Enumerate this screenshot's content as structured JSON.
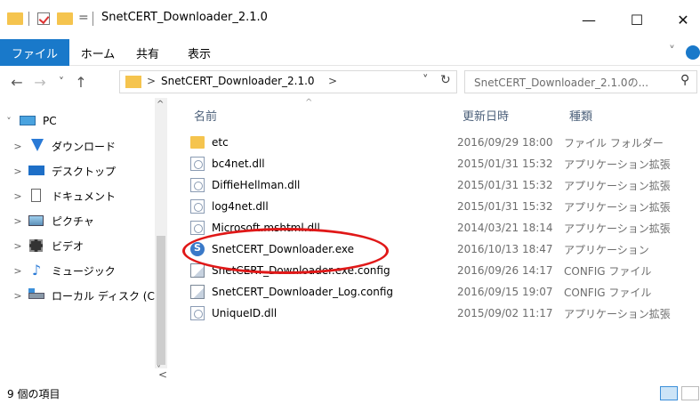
{
  "window": {
    "title": "SnetCERT_Downloader_2.1.0",
    "qat_dropdown": "=",
    "minimize": "—",
    "maximize": "☐",
    "close": "✕"
  },
  "ribbon": {
    "tabs": [
      {
        "label": "ファイル"
      },
      {
        "label": "ホーム"
      },
      {
        "label": "共有"
      },
      {
        "label": "表示"
      }
    ],
    "expand": "˅"
  },
  "address": {
    "back": "←",
    "forward": "→",
    "recent": "˅",
    "up": "↑",
    "crumb_sep": ">",
    "path": "SnetCERT_Downloader_2.1.0",
    "path_sep": ">",
    "dropdown": "˅",
    "refresh": "↻",
    "search_placeholder": "SnetCERT_Downloader_2.1.0の...",
    "search_icon": "⚲"
  },
  "nav": {
    "items": [
      {
        "label": "PC",
        "icon": "pc-icon",
        "expanded": true
      },
      {
        "label": "ダウンロード",
        "icon": "download-icon"
      },
      {
        "label": "デスクトップ",
        "icon": "desktop-icon"
      },
      {
        "label": "ドキュメント",
        "icon": "documents-icon"
      },
      {
        "label": "ピクチャ",
        "icon": "pictures-icon"
      },
      {
        "label": "ビデオ",
        "icon": "videos-icon"
      },
      {
        "label": "ミュージック",
        "icon": "music-icon"
      },
      {
        "label": "ローカル ディスク (C",
        "icon": "local-disk-icon"
      }
    ],
    "chev_expanded": "˅",
    "chev_collapsed": ">"
  },
  "columns": {
    "name": "名前",
    "date": "更新日時",
    "type": "種類",
    "sort_indicator": "^"
  },
  "files": [
    {
      "name": "etc",
      "date": "2016/09/29 18:00",
      "type": "ファイル フォルダー",
      "icon": "folder"
    },
    {
      "name": "bc4net.dll",
      "date": "2015/01/31 15:32",
      "type": "アプリケーション拡張",
      "icon": "dll"
    },
    {
      "name": "DiffieHellman.dll",
      "date": "2015/01/31 15:32",
      "type": "アプリケーション拡張",
      "icon": "dll"
    },
    {
      "name": "log4net.dll",
      "date": "2015/01/31 15:32",
      "type": "アプリケーション拡張",
      "icon": "dll"
    },
    {
      "name": "Microsoft.mshtml.dll",
      "date": "2014/03/21 18:14",
      "type": "アプリケーション拡張",
      "icon": "dll"
    },
    {
      "name": "SnetCERT_Downloader.exe",
      "date": "2016/10/13 18:47",
      "type": "アプリケーション",
      "icon": "exe"
    },
    {
      "name": "SnetCERT_Downloader.exe.config",
      "date": "2016/09/26 14:17",
      "type": "CONFIG ファイル",
      "icon": "cfg"
    },
    {
      "name": "SnetCERT_Downloader_Log.config",
      "date": "2016/09/15 19:07",
      "type": "CONFIG ファイル",
      "icon": "cfg"
    },
    {
      "name": "UniqueID.dll",
      "date": "2015/09/02 11:17",
      "type": "アプリケーション拡張",
      "icon": "dll"
    }
  ],
  "status": {
    "item_count": "9 個の項目"
  },
  "scroll": {
    "left_arrow": "<",
    "up_arrow": "^",
    "down_arrow": "˅"
  },
  "colors": {
    "file_tab": "#1979ca",
    "folder": "#f5c44e",
    "highlight": "#e01818"
  }
}
